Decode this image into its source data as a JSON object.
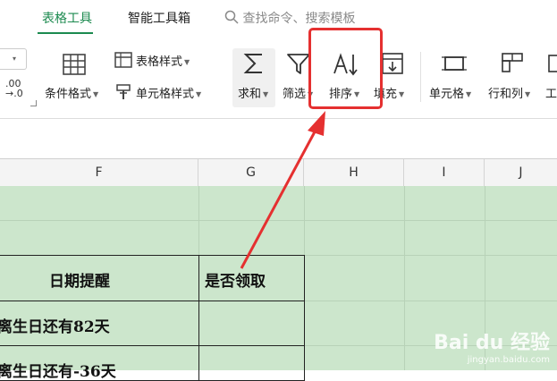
{
  "tabs": [
    {
      "label": "表格工具",
      "active": true
    },
    {
      "label": "智能工具箱",
      "active": false
    }
  ],
  "search": {
    "text": "查找命令、搜索模板"
  },
  "ribbon": {
    "left_number": {
      "top": ".00",
      "bottom": "→.0"
    },
    "conditional_format": "条件格式",
    "table_style": "表格样式",
    "cell_style": "单元格样式",
    "sum": "求和",
    "filter": "筛选",
    "sort": "排序",
    "fill": "填充",
    "cell": "单元格",
    "rowcol": "行和列",
    "tools_cut": "工"
  },
  "columns": [
    "F",
    "G",
    "H",
    "I",
    "J"
  ],
  "cells": {
    "f_header": "日期提醒",
    "g_header": "是否领取",
    "f_row1": "离生日还有82天",
    "f_row2": "离生日还有-36天"
  },
  "watermark": {
    "brand": "Bai du 经验",
    "url": "jingyan.baidu.com"
  },
  "colors": {
    "accent": "#1c8a4f",
    "highlight": "#e53030",
    "sheet": "#cce6cc"
  }
}
